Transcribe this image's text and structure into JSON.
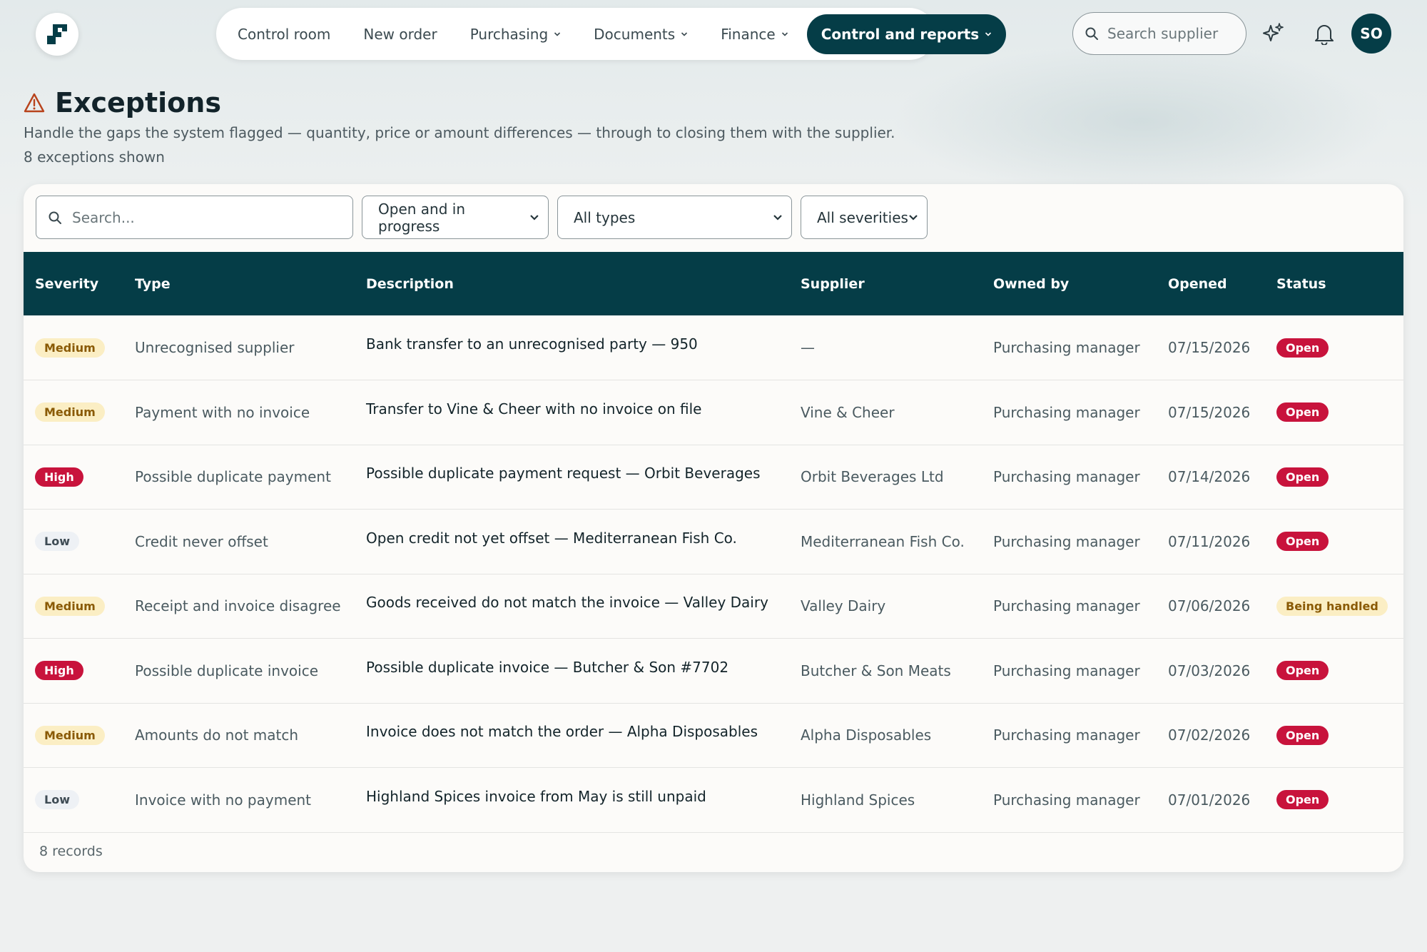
{
  "nav": {
    "items": [
      {
        "label": "Control room",
        "has_menu": false,
        "active": false
      },
      {
        "label": "New order",
        "has_menu": false,
        "active": false
      },
      {
        "label": "Purchasing",
        "has_menu": true,
        "active": false
      },
      {
        "label": "Documents",
        "has_menu": true,
        "active": false
      },
      {
        "label": "Finance",
        "has_menu": true,
        "active": false
      },
      {
        "label": "Control and reports",
        "has_menu": true,
        "active": true
      }
    ],
    "supplier_search_placeholder": "Search supplier",
    "avatar_initials": "SO"
  },
  "page": {
    "title": "Exceptions",
    "subtitle": "Handle the gaps the system flagged — quantity, price or amount differences — through to closing them with the supplier.",
    "count_text": "8 exceptions shown"
  },
  "filters": {
    "search_placeholder": "Search...",
    "status": "Open and in progress",
    "type": "All types",
    "severity": "All severities"
  },
  "table": {
    "columns": [
      "Severity",
      "Type",
      "Description",
      "Supplier",
      "Owned by",
      "Opened",
      "Status"
    ],
    "rows": [
      {
        "severity": "Medium",
        "type": "Unrecognised supplier",
        "description": "Bank transfer to an unrecognised party — 950",
        "supplier": "—",
        "owner": "Purchasing manager",
        "opened": "07/15/2026",
        "status": "Open"
      },
      {
        "severity": "Medium",
        "type": "Payment with no invoice",
        "description": "Transfer to Vine & Cheer with no invoice on file",
        "supplier": "Vine & Cheer",
        "owner": "Purchasing manager",
        "opened": "07/15/2026",
        "status": "Open"
      },
      {
        "severity": "High",
        "type": "Possible duplicate payment",
        "description": "Possible duplicate payment request — Orbit Beverages",
        "supplier": "Orbit Beverages Ltd",
        "owner": "Purchasing manager",
        "opened": "07/14/2026",
        "status": "Open"
      },
      {
        "severity": "Low",
        "type": "Credit never offset",
        "description": "Open credit not yet offset — Mediterranean Fish Co.",
        "supplier": "Mediterranean Fish Co.",
        "owner": "Purchasing manager",
        "opened": "07/11/2026",
        "status": "Open"
      },
      {
        "severity": "Medium",
        "type": "Receipt and invoice disagree",
        "description": "Goods received do not match the invoice — Valley Dairy",
        "supplier": "Valley Dairy",
        "owner": "Purchasing manager",
        "opened": "07/06/2026",
        "status": "Being handled"
      },
      {
        "severity": "High",
        "type": "Possible duplicate invoice",
        "description": "Possible duplicate invoice — Butcher & Son #7702",
        "supplier": "Butcher & Son Meats",
        "owner": "Purchasing manager",
        "opened": "07/03/2026",
        "status": "Open"
      },
      {
        "severity": "Medium",
        "type": "Amounts do not match",
        "description": "Invoice does not match the order — Alpha Disposables",
        "supplier": "Alpha Disposables",
        "owner": "Purchasing manager",
        "opened": "07/02/2026",
        "status": "Open"
      },
      {
        "severity": "Low",
        "type": "Invoice with no payment",
        "description": "Highland Spices invoice from May is still unpaid",
        "supplier": "Highland Spices",
        "owner": "Purchasing manager",
        "opened": "07/01/2026",
        "status": "Open"
      }
    ],
    "footer": "8 records"
  },
  "colors": {
    "brand": "#053d47",
    "danger": "#c8133c",
    "warning_bg": "#fbeec4",
    "warning_text": "#8a5a05"
  },
  "icons": {
    "title": "warning-triangle-icon",
    "search": "search-icon",
    "assistant": "sparkle-icon",
    "notifications": "bell-icon"
  }
}
